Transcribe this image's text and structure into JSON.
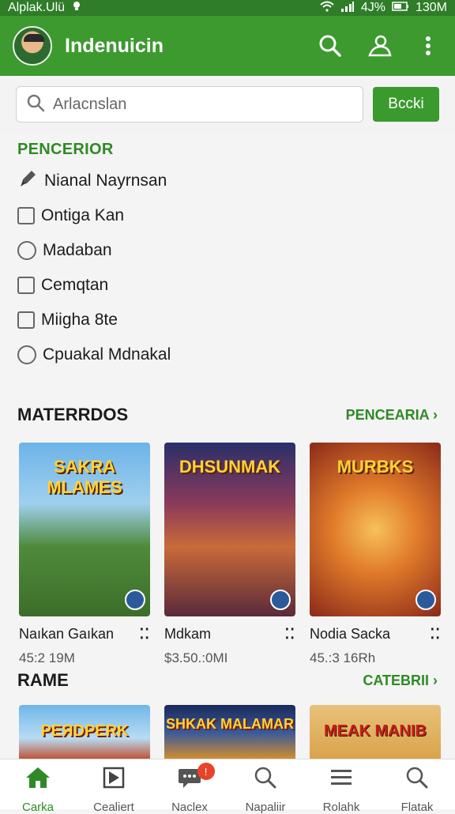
{
  "statusbar": {
    "carrier": "Alplak.Ulü",
    "battery_text": "4J%",
    "time": "130M"
  },
  "appbar": {
    "title": "Indenuicin"
  },
  "search": {
    "placeholder": "Arlacnslan",
    "button_label": "Bccki"
  },
  "filters": {
    "heading": "PENCERIOR",
    "items": [
      {
        "label": "Nianal Nayrnsan",
        "control": "pencil",
        "checked": false
      },
      {
        "label": "Ontiga Kan",
        "control": "checkbox",
        "checked": false
      },
      {
        "label": "Madaban",
        "control": "radio",
        "checked": false
      },
      {
        "label": "Cemqtan",
        "control": "checkbox",
        "checked": false
      },
      {
        "label": "Miigha 8te",
        "control": "checkbox",
        "checked": false
      },
      {
        "label": "Cpuakal Mdnakal",
        "control": "radio",
        "checked": false
      }
    ]
  },
  "section1": {
    "title": "MATERRDOS",
    "link": "PENCEARIA ›",
    "cards": [
      {
        "cover_text": "SAKRA MLAMES",
        "title": "Naıkan Gaıkan",
        "price": "45:2 19M"
      },
      {
        "cover_text": "DHSUNMAK",
        "title": "Mdkam",
        "price": "$3.50.:0MI"
      },
      {
        "cover_text": "MURBKS",
        "title": "Nodia Sacka",
        "price": "45.:3 16Rh"
      }
    ]
  },
  "section2": {
    "title": "RAME",
    "link": "CATEBRII ›",
    "cards": [
      {
        "cover_text": "PEЯDPERK"
      },
      {
        "cover_text": "SHKAK MALAMAR"
      },
      {
        "cover_text": "MEAK MANIB"
      }
    ]
  },
  "bottomnav": {
    "items": [
      {
        "label": "Carka",
        "icon": "home-icon"
      },
      {
        "label": "Cealiert",
        "icon": "flag-icon"
      },
      {
        "label": "Naclex",
        "icon": "chat-icon",
        "badge": "!"
      },
      {
        "label": "Napaliir",
        "icon": "search-icon"
      },
      {
        "label": "Rolahk",
        "icon": "menu-icon"
      },
      {
        "label": "Flatak",
        "icon": "search-icon"
      }
    ]
  },
  "colors": {
    "primary": "#3c9a2f",
    "accent_text": "#2f8a25"
  }
}
